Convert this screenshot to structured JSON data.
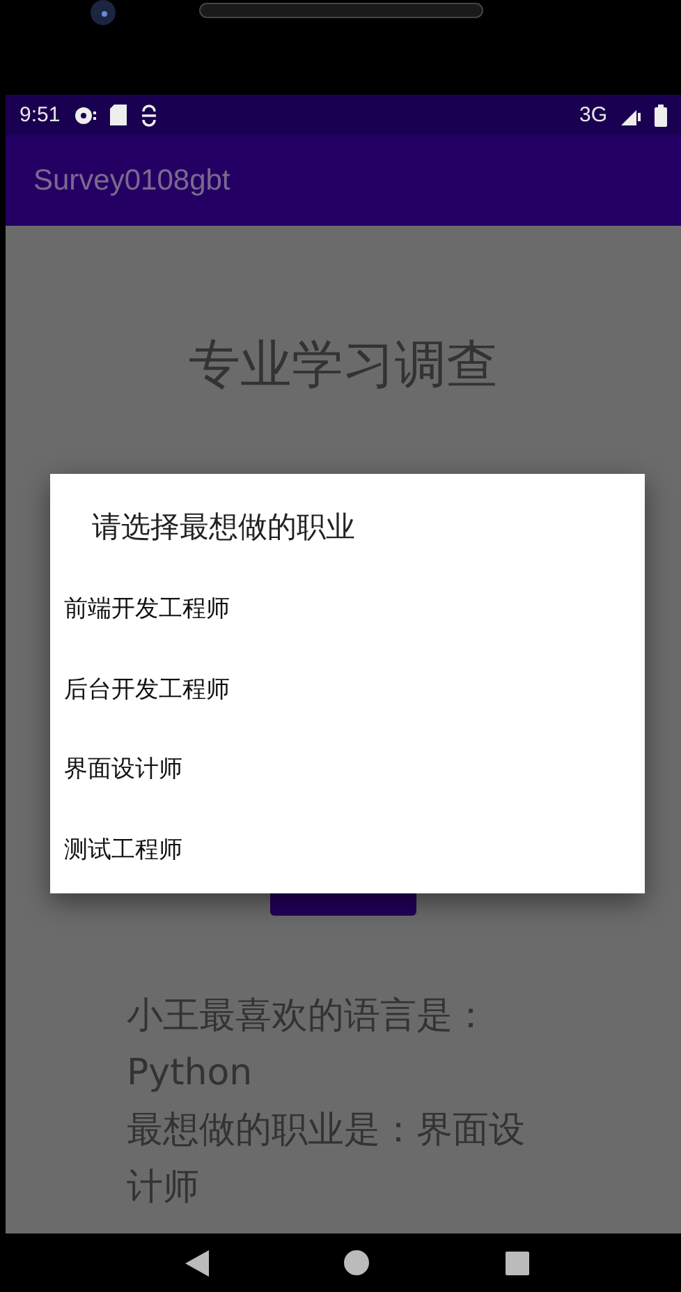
{
  "status_bar": {
    "time": "9:51",
    "network": "3G"
  },
  "app_bar": {
    "title": "Survey0108gbt"
  },
  "page": {
    "heading": "专业学习调查",
    "result_lines": [
      "小王最喜欢的语言是：Python",
      "最想做的职业是：界面设计师"
    ]
  },
  "dialog": {
    "title": "请选择最想做的职业",
    "items": [
      {
        "label": "前端开发工程师"
      },
      {
        "label": "后台开发工程师"
      },
      {
        "label": "界面设计师"
      },
      {
        "label": "测试工程师"
      }
    ]
  }
}
